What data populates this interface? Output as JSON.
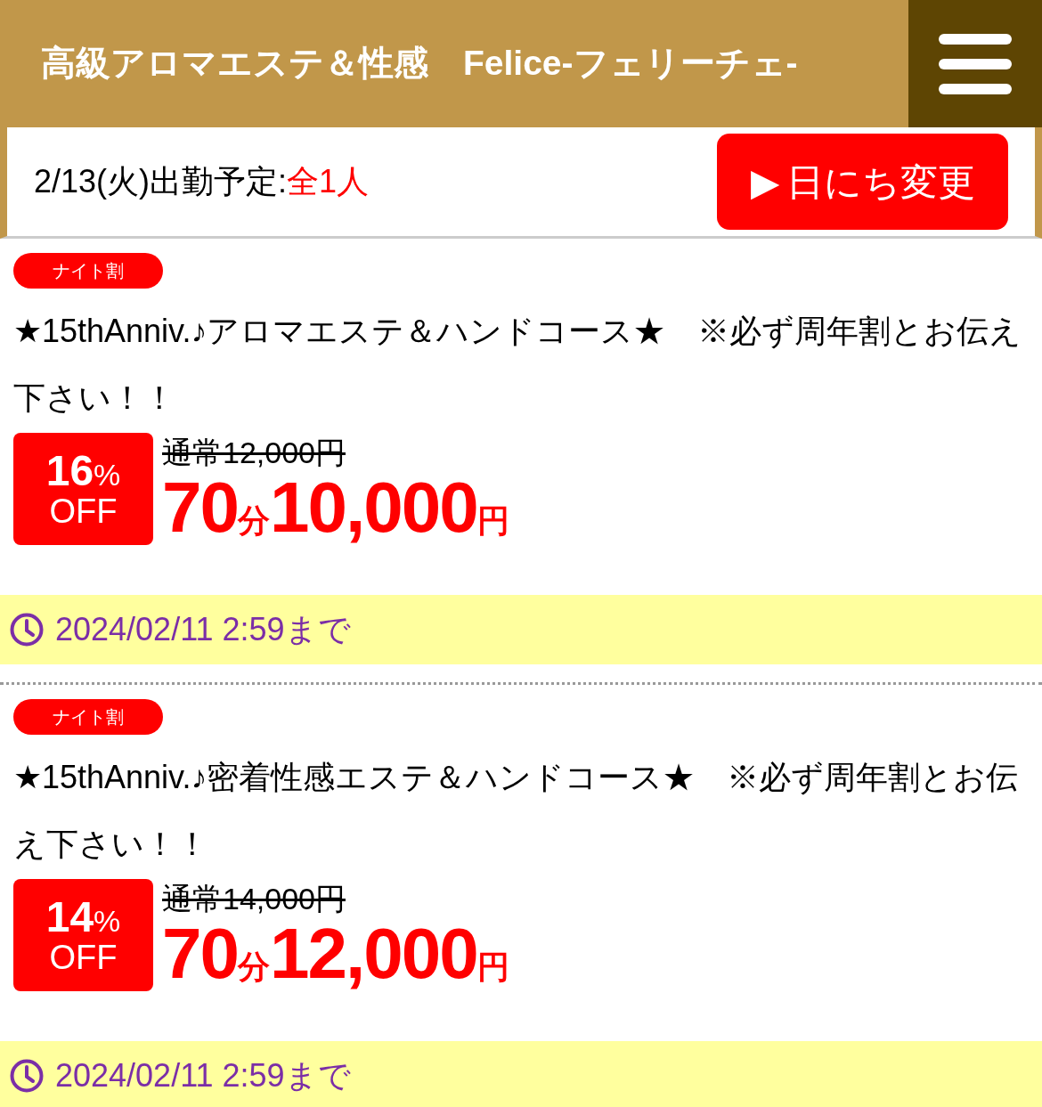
{
  "header": {
    "title": "高級アロマエステ＆性感　Felice-フェリーチェ-"
  },
  "schedule": {
    "date_label": "2/13(火)出勤予定:",
    "count": "全1人",
    "button_icon": "▶",
    "button_label": "日にち変更"
  },
  "coupons": [
    {
      "badge": "ナイト割",
      "title": "★15thAnniv.♪アロマエステ＆ハンドコース★　※必ず周年割とお伝え下さい！！",
      "discount": "16",
      "discount_unit": "%",
      "discount_label": "OFF",
      "regular_price": "通常12,000円",
      "duration": "70",
      "duration_unit": "分",
      "price": "10,000",
      "currency": "円",
      "deadline": "2024/02/11 2:59まで"
    },
    {
      "badge": "ナイト割",
      "title": "★15thAnniv.♪密着性感エステ＆ハンドコース★　※必ず周年割とお伝え下さい！！",
      "discount": "14",
      "discount_unit": "%",
      "discount_label": "OFF",
      "regular_price": "通常14,000円",
      "duration": "70",
      "duration_unit": "分",
      "price": "12,000",
      "currency": "円",
      "deadline": "2024/02/11 2:59まで"
    }
  ]
}
